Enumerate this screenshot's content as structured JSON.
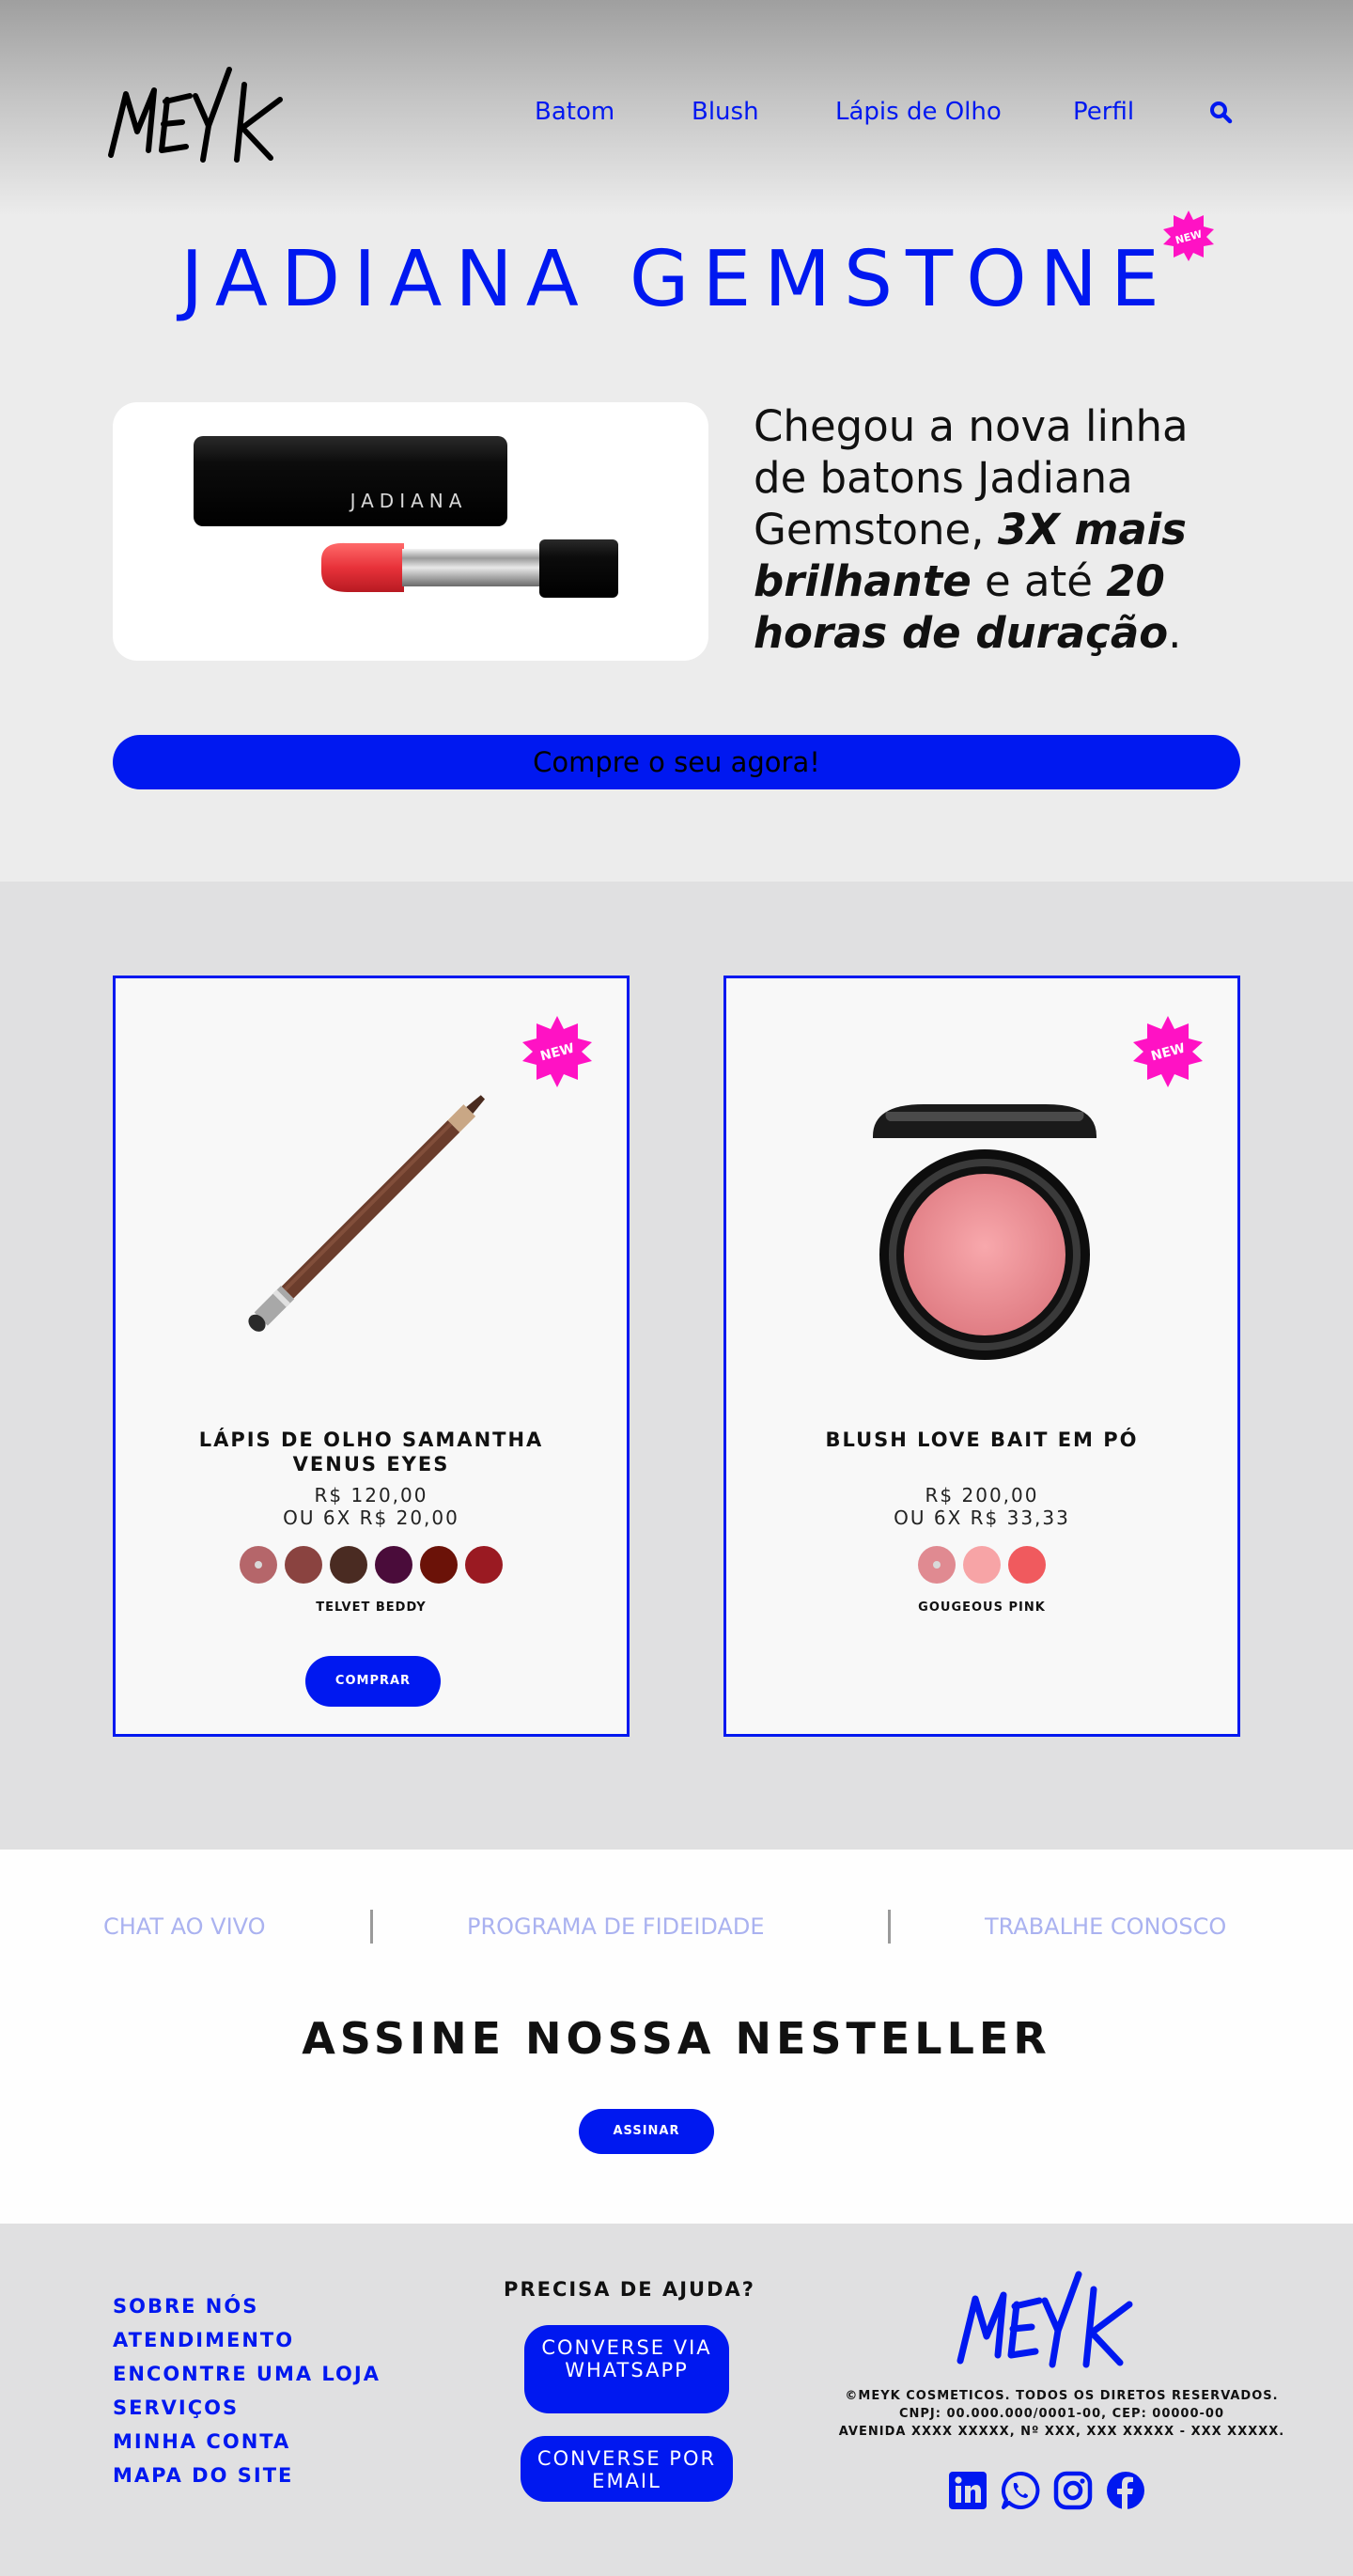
{
  "brand": {
    "logo_text": "MEYK",
    "accent": "#0018f0",
    "new_badge_color": "#ff12c4"
  },
  "nav": {
    "items": [
      {
        "label": "Batom"
      },
      {
        "label": "Blush"
      },
      {
        "label": "Lápis de Olho"
      },
      {
        "label": "Perfil"
      }
    ],
    "search_icon": "search-icon"
  },
  "hero": {
    "title": "JADIANA GEMSTONE",
    "badge": "NEW",
    "product_brand_text": "JADIANA",
    "text_part1": "Chegou a nova linha de batons Jadiana Gemstone, ",
    "text_bold1": "3X mais brilhante",
    "text_part2": " e até ",
    "text_bold2": "20 horas de duração",
    "text_part3": ".",
    "cta": "Compre o seu agora!"
  },
  "products": [
    {
      "badge": "NEW",
      "name_line1": "LÁPIS DE OLHO SAMANTHA",
      "name_line2": "VENUS EYES",
      "price": "R$ 120,00",
      "installments": "OU 6X R$ 20,00",
      "swatches": [
        "#b5666a",
        "#8a4340",
        "#4a2b22",
        "#4a0c3a",
        "#6b1208",
        "#9a1a22"
      ],
      "selected_shade": "TELVET BEDDY",
      "buy_label": "COMPRAR"
    },
    {
      "badge": "NEW",
      "name_line1": "BLUSH LOVE BAIT EM PÓ",
      "name_line2": "",
      "price": "R$ 200,00",
      "installments": "OU 6X R$ 33,33",
      "swatches": [
        "#e08a91",
        "#f7a4a6",
        "#f05a5e"
      ],
      "selected_shade": "GOUGEOUS PINK"
    }
  ],
  "links_band": {
    "links": [
      "CHAT AO VIVO",
      "PROGRAMA DE FIDEIDADE",
      "TRABALHE CONOSCO"
    ],
    "newsletter_title": "ASSINE NOSSA NESTELLER",
    "subscribe_label": "ASSINAR"
  },
  "footer": {
    "links": [
      "SOBRE NÓS",
      "ATENDIMENTO",
      "ENCONTRE UMA LOJA",
      "SERVIÇOS",
      "MINHA CONTA",
      "MAPA DO SITE"
    ],
    "help_title": "PRECISA DE AJUDA?",
    "whatsapp_line1": "CONVERSE VIA",
    "whatsapp_line2": "WHATSAPP",
    "email_line1": "CONVERSE POR",
    "email_line2": "EMAIL",
    "legal_line1": "©MEYK COSMETICOS. TODOS OS DIRETOS RESERVADOS.",
    "legal_line2": "CNPJ: 00.000.000/0001-00, CEP: 00000-00",
    "legal_line3": "AVENIDA XXXX XXXXX, Nº XXX, XXX XXXXX - XXX XXXXX.",
    "social_icons": [
      "linkedin-icon",
      "whatsapp-icon",
      "instagram-icon",
      "facebook-icon"
    ]
  }
}
